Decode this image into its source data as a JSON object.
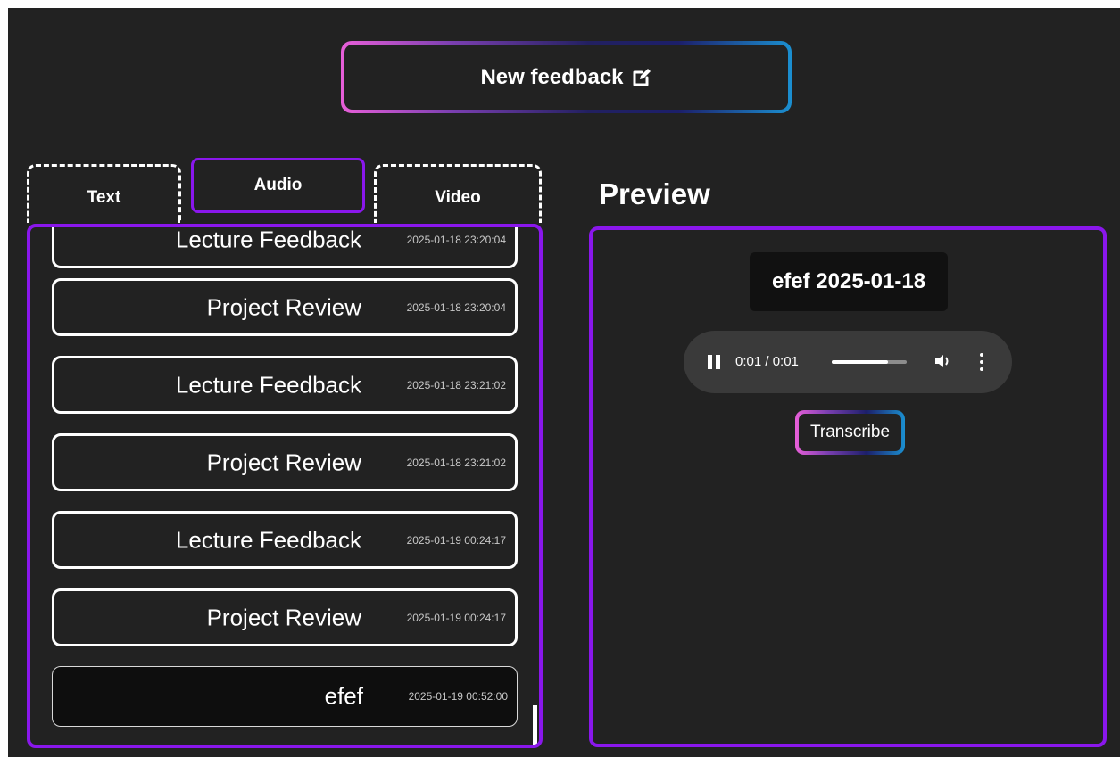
{
  "header": {
    "new_feedback_label": "New feedback",
    "new_feedback_icon": "edit-icon"
  },
  "tabs": [
    {
      "label": "Text"
    },
    {
      "label": "Audio",
      "active": true
    },
    {
      "label": "Video"
    }
  ],
  "list": {
    "items": [
      {
        "title": "Lecture Feedback",
        "timestamp": "2025-01-18 23:20:04"
      },
      {
        "title": "Project Review",
        "timestamp": "2025-01-18 23:20:04"
      },
      {
        "title": "Lecture Feedback",
        "timestamp": "2025-01-18 23:21:02"
      },
      {
        "title": "Project Review",
        "timestamp": "2025-01-18 23:21:02"
      },
      {
        "title": "Lecture Feedback",
        "timestamp": "2025-01-19 00:24:17"
      },
      {
        "title": "Project Review",
        "timestamp": "2025-01-19 00:24:17"
      },
      {
        "title": "efef",
        "timestamp": "2025-01-19 00:52:00",
        "selected": true
      }
    ]
  },
  "preview": {
    "heading": "Preview",
    "recording_title": "efef 2025-01-18",
    "player": {
      "time": "0:01 / 0:01",
      "progress_fraction": 0.75
    },
    "transcribe_label": "Transcribe"
  },
  "colors": {
    "background": "#222222",
    "accent_purple": "#8a17ec",
    "gradient_pink": "#e85fd9",
    "gradient_blue": "#1b8fd0"
  }
}
